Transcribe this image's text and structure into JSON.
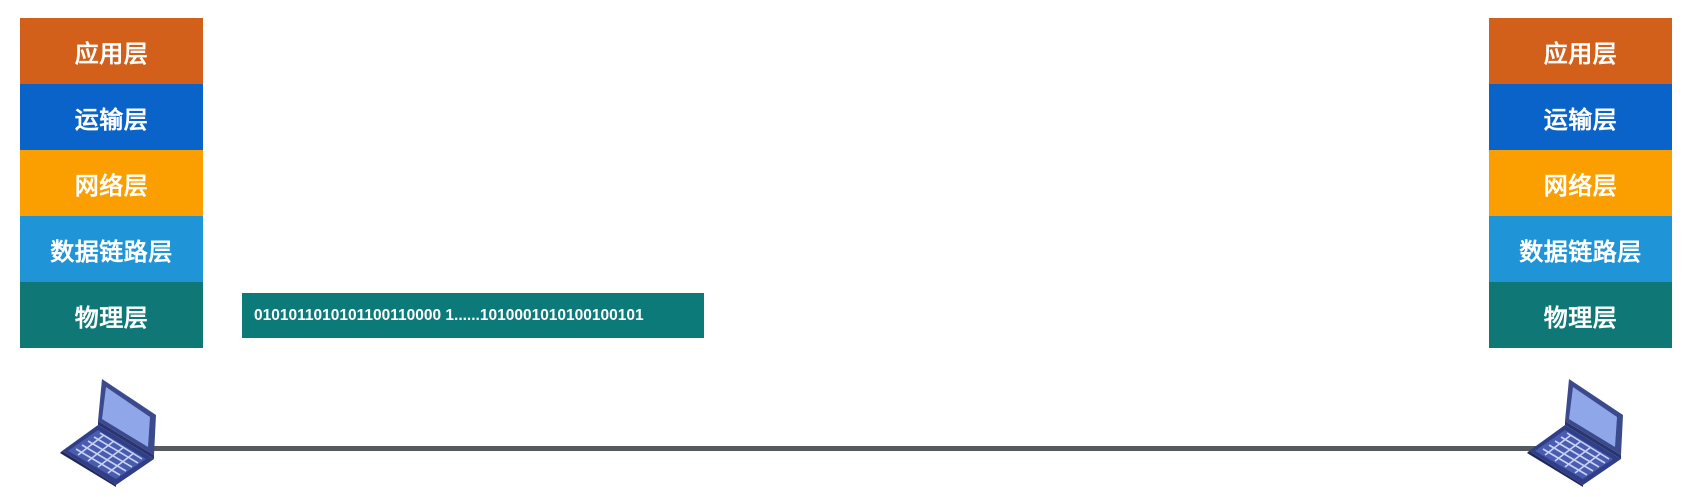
{
  "left_host": {
    "layers": [
      {
        "label": "应用层",
        "color": "#d2601a"
      },
      {
        "label": "运输层",
        "color": "#0a63c9"
      },
      {
        "label": "网络层",
        "color": "#fb9f00"
      },
      {
        "label": "数据链路层",
        "color": "#1f94d6"
      },
      {
        "label": "物理层",
        "color": "#0f7877"
      }
    ],
    "icon": "laptop-icon"
  },
  "right_host": {
    "layers": [
      {
        "label": "应用层",
        "color": "#d2601a"
      },
      {
        "label": "运输层",
        "color": "#0a63c9"
      },
      {
        "label": "网络层",
        "color": "#fb9f00"
      },
      {
        "label": "数据链路层",
        "color": "#1f94d6"
      },
      {
        "label": "物理层",
        "color": "#0f7877"
      }
    ],
    "icon": "laptop-icon"
  },
  "bitstream": {
    "text": "0101011010101100110000 1......1010001010100100101",
    "color": "#0d7a7a"
  },
  "link": {
    "color": "#555a5e"
  }
}
